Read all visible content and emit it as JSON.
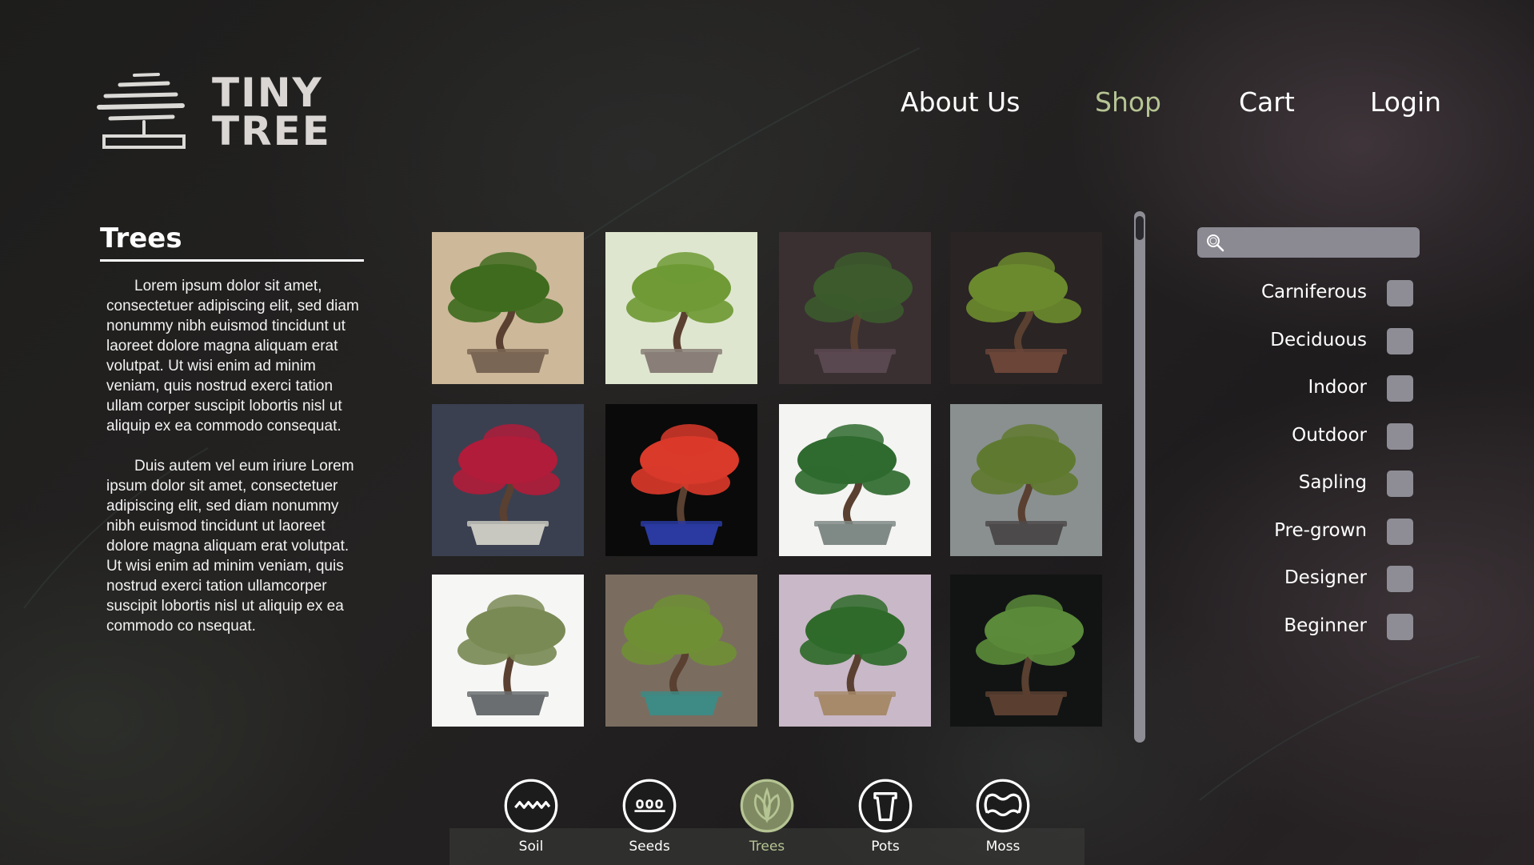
{
  "brand": {
    "line1": "TINY",
    "line2": "TREE"
  },
  "nav": [
    {
      "label": "About Us",
      "active": false
    },
    {
      "label": "Shop",
      "active": true
    },
    {
      "label": "Cart",
      "active": false
    },
    {
      "label": "Login",
      "active": false
    }
  ],
  "sidebar": {
    "title": "Trees",
    "paragraphs": [
      "Lorem ipsum dolor sit amet, consectetuer adipiscing elit, sed diam nonummy nibh euismod tincidunt ut laoreet dolore magna aliquam erat volutpat. Ut wisi enim ad minim veniam, quis nostrud exerci tation ullam corper suscipit lobortis nisl ut aliquip ex ea commodo consequat.",
      "Duis autem vel eum iriure Lorem ipsum dolor sit amet, consectetuer adipiscing elit, sed diam nonummy nibh euismod tincidunt ut laoreet dolore magna aliquam erat volutpat. Ut wisi enim ad minim veniam, quis nostrud exerci tation ullamcorper suscipit lobortis nisl ut aliquip ex ea commodo co nsequat."
    ]
  },
  "search": {
    "placeholder": "",
    "value": ""
  },
  "filters": [
    {
      "label": "Carniferous",
      "checked": false
    },
    {
      "label": "Deciduous",
      "checked": false
    },
    {
      "label": "Indoor",
      "checked": false
    },
    {
      "label": "Outdoor",
      "checked": false
    },
    {
      "label": "Sapling",
      "checked": false
    },
    {
      "label": "Pre-grown",
      "checked": false
    },
    {
      "label": "Designer",
      "checked": false
    },
    {
      "label": "Beginner",
      "checked": false
    }
  ],
  "products": [
    {
      "bg": "#cdb89a",
      "foliage": "#3f6b1e",
      "pot": "#7a6654"
    },
    {
      "bg": "#dfe6cf",
      "foliage": "#6f9a35",
      "pot": "#8a7f78"
    },
    {
      "bg": "#3a3032",
      "foliage": "#3c5a2c",
      "pot": "#5a4850"
    },
    {
      "bg": "#2a2424",
      "foliage": "#6b8a2e",
      "pot": "#6a4538"
    },
    {
      "bg": "#3a4050",
      "foliage": "#b01c3a",
      "pot": "#c8c8c0"
    },
    {
      "bg": "#0a0a0a",
      "foliage": "#d93a2a",
      "pot": "#2a3aa0"
    },
    {
      "bg": "#f4f4f2",
      "foliage": "#2f6a2f",
      "pot": "#7f8a86"
    },
    {
      "bg": "#8a9090",
      "foliage": "#5f7a30",
      "pot": "#4c4a4a"
    },
    {
      "bg": "#f6f6f4",
      "foliage": "#7a8a55",
      "pot": "#6a6e70"
    },
    {
      "bg": "#7a6d60",
      "foliage": "#6f8f35",
      "pot": "#3e8a85"
    },
    {
      "bg": "#c9b8c8",
      "foliage": "#2f6a2a",
      "pot": "#a68a6a"
    },
    {
      "bg": "#121414",
      "foliage": "#5a8a3a",
      "pot": "#5a3f30"
    }
  ],
  "categories": [
    {
      "label": "Soil",
      "icon": "soil-icon",
      "active": false
    },
    {
      "label": "Seeds",
      "icon": "seeds-icon",
      "active": false
    },
    {
      "label": "Trees",
      "icon": "leaf-icon",
      "active": true
    },
    {
      "label": "Pots",
      "icon": "pot-icon",
      "active": false
    },
    {
      "label": "Moss",
      "icon": "moss-icon",
      "active": false
    }
  ],
  "colors": {
    "accent": "#b5c493",
    "control": "#8e8d95"
  }
}
